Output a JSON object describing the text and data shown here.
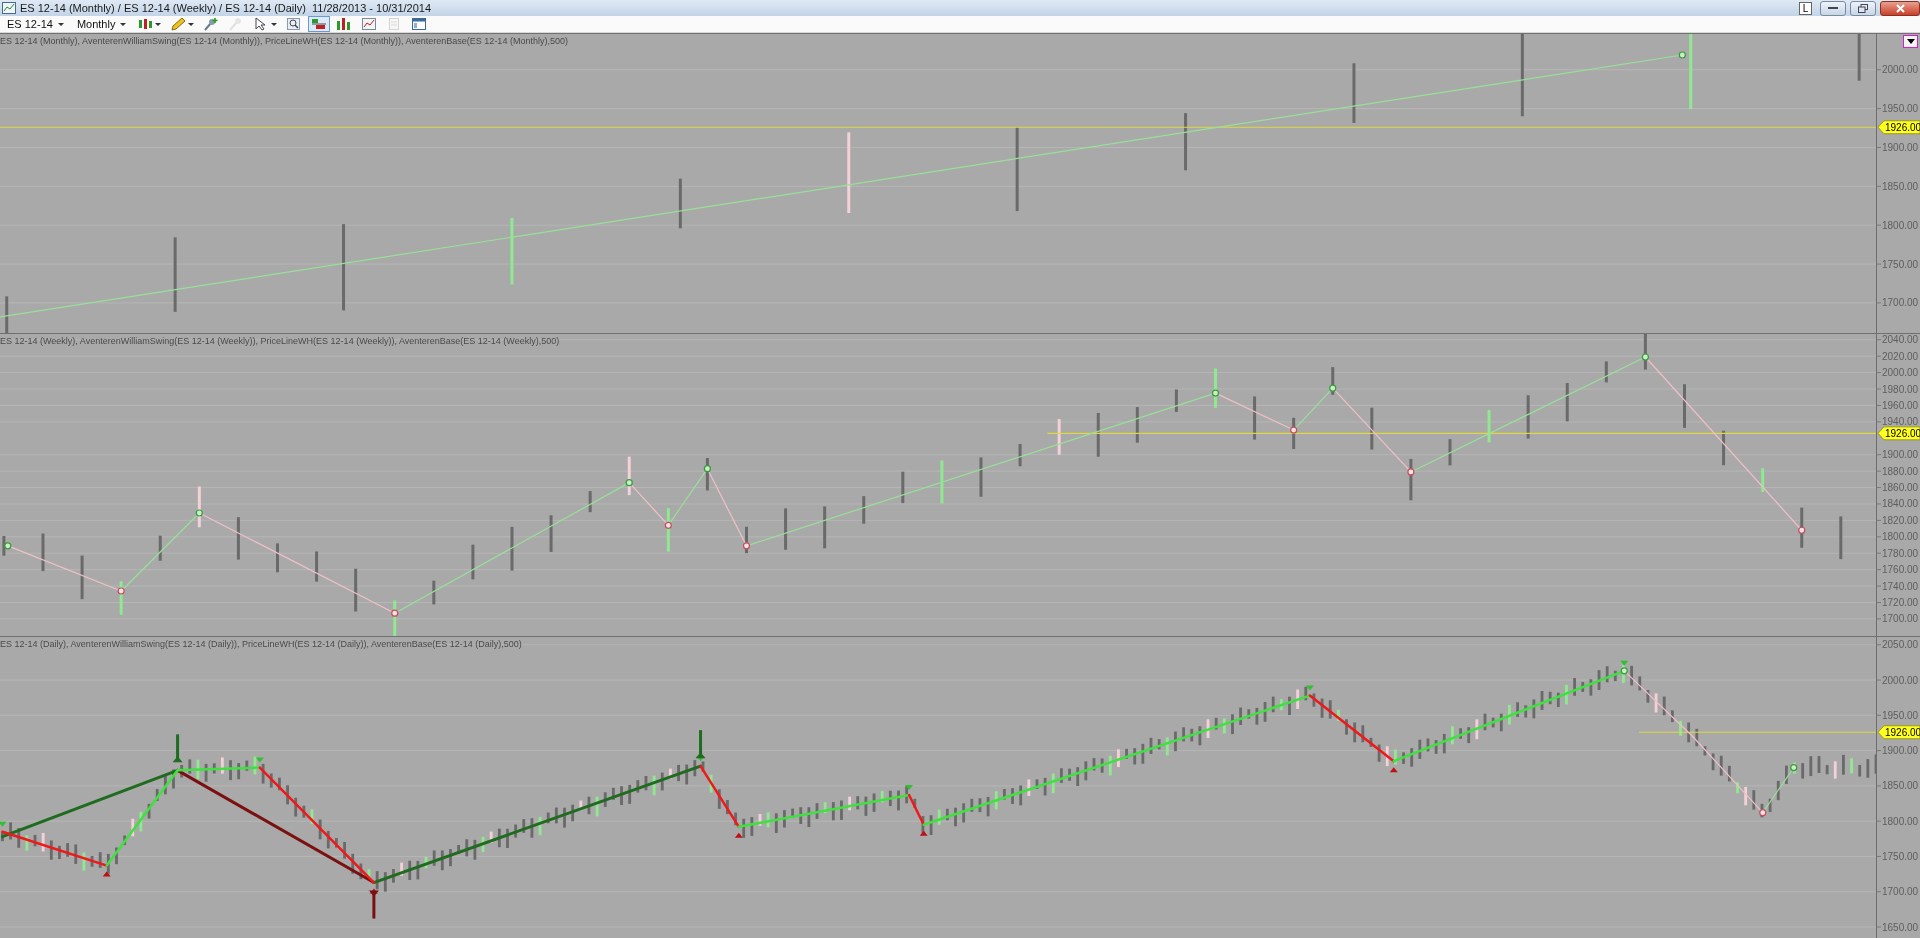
{
  "window": {
    "title": "ES 12-14 (Monthly) / ES 12-14 (Weekly) / ES 12-14 (Daily)  11/28/2013 - 10/31/2014",
    "layout_button": "L"
  },
  "toolbar": {
    "symbol": "ES 12-14",
    "interval": "Monthly",
    "tools": [
      {
        "kind": "bars",
        "dropdown": true,
        "selected": false,
        "disabled": false
      },
      {
        "kind": "pencil",
        "dropdown": true,
        "selected": false,
        "disabled": false
      },
      {
        "kind": "add-point",
        "dropdown": false,
        "selected": false,
        "disabled": false
      },
      {
        "kind": "line-tool",
        "dropdown": false,
        "selected": false,
        "disabled": true
      },
      {
        "kind": "pointer",
        "dropdown": true,
        "selected": false,
        "disabled": false
      },
      {
        "kind": "zoom",
        "dropdown": false,
        "selected": false,
        "disabled": false
      },
      {
        "kind": "panels",
        "dropdown": false,
        "selected": true,
        "disabled": false
      },
      {
        "kind": "bar-colors",
        "dropdown": false,
        "selected": false,
        "disabled": false
      },
      {
        "kind": "line-chart",
        "dropdown": false,
        "selected": false,
        "disabled": false
      },
      {
        "kind": "page",
        "dropdown": false,
        "selected": false,
        "disabled": true
      },
      {
        "kind": "window",
        "dropdown": false,
        "selected": false,
        "disabled": false
      }
    ]
  },
  "panels": [
    {
      "legend": "ES 12-14 (Monthly), AventerenWilliamSwing(ES 12-14 (Monthly)), PriceLineWH(ES 12-14 (Monthly)), AventerenBase(ES 12-14 (Monthly),500)",
      "has_menu_button": true,
      "price_axis": [
        "2000.00",
        "1950.00",
        "1900.00",
        "1850.00",
        "1800.00",
        "1750.00",
        "1700.00"
      ],
      "price_tag": "1926.00"
    },
    {
      "legend": "ES 12-14 (Weekly), AventerenWilliamSwing(ES 12-14 (Weekly)), PriceLineWH(ES 12-14 (Weekly)), AventerenBase(ES 12-14 (Weekly),500)",
      "has_menu_button": false,
      "price_axis": [
        "2040.00",
        "2020.00",
        "2000.00",
        "1980.00",
        "1960.00",
        "1940.00",
        "1900.00",
        "1880.00",
        "1860.00",
        "1840.00",
        "1820.00",
        "1800.00",
        "1780.00",
        "1760.00",
        "1740.00",
        "1720.00",
        "1700.00"
      ],
      "price_tag": "1926.00"
    },
    {
      "legend": "ES 12-14 (Daily), AventerenWilliamSwing(ES 12-14 (Daily)), PriceLineWH(ES 12-14 (Daily)), AventerenBase(ES 12-14 (Daily),500)",
      "has_menu_button": false,
      "price_axis": [
        "2050.00",
        "2000.00",
        "1950.00",
        "1900.00",
        "1850.00",
        "1800.00",
        "1750.00",
        "1700.00",
        "1650.00"
      ],
      "price_tag": "1926.00"
    }
  ]
}
